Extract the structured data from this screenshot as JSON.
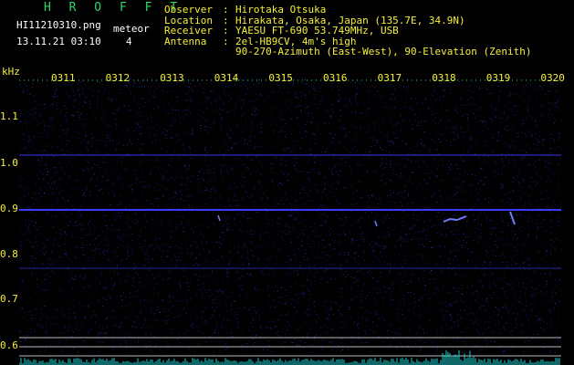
{
  "header": {
    "program": "H R O F F T",
    "filename": "HI11210310.png",
    "datetime": "13.11.21 03:10",
    "meteor_label": "meteor",
    "meteor_count": "4"
  },
  "info": [
    {
      "label": "Observer",
      "value": "Hirotaka Otsuka"
    },
    {
      "label": "Location",
      "value": "Hirakata, Osaka, Japan (135.7E, 34.9N)"
    },
    {
      "label": "Receiver",
      "value": "YAESU FT-690 53.749MHz, USB"
    },
    {
      "label": "Antenna",
      "value": "2el-HB9CV, 4m's high"
    },
    {
      "label": "",
      "value": "90-270-Azimuth (East-West), 90-Elevation (Zenith)"
    }
  ],
  "axis": {
    "unit": "kHz",
    "time_ticks": [
      "0311",
      "0312",
      "0313",
      "0314",
      "0315",
      "0316",
      "0317",
      "0318",
      "0319",
      "0320"
    ],
    "freq_ticks": [
      "1.1",
      "1.0",
      "0.9",
      "0.8",
      "0.7",
      "0.6"
    ]
  },
  "colors": {
    "background": "#000000",
    "label_green": "#2bd66a",
    "info_yellow": "#f4ef3a",
    "noise_blue": "#1a1a7a",
    "signal_line": "#3b3bff",
    "echo": "#6f7dff",
    "baseline_cyan": "#1fd0d0"
  }
}
